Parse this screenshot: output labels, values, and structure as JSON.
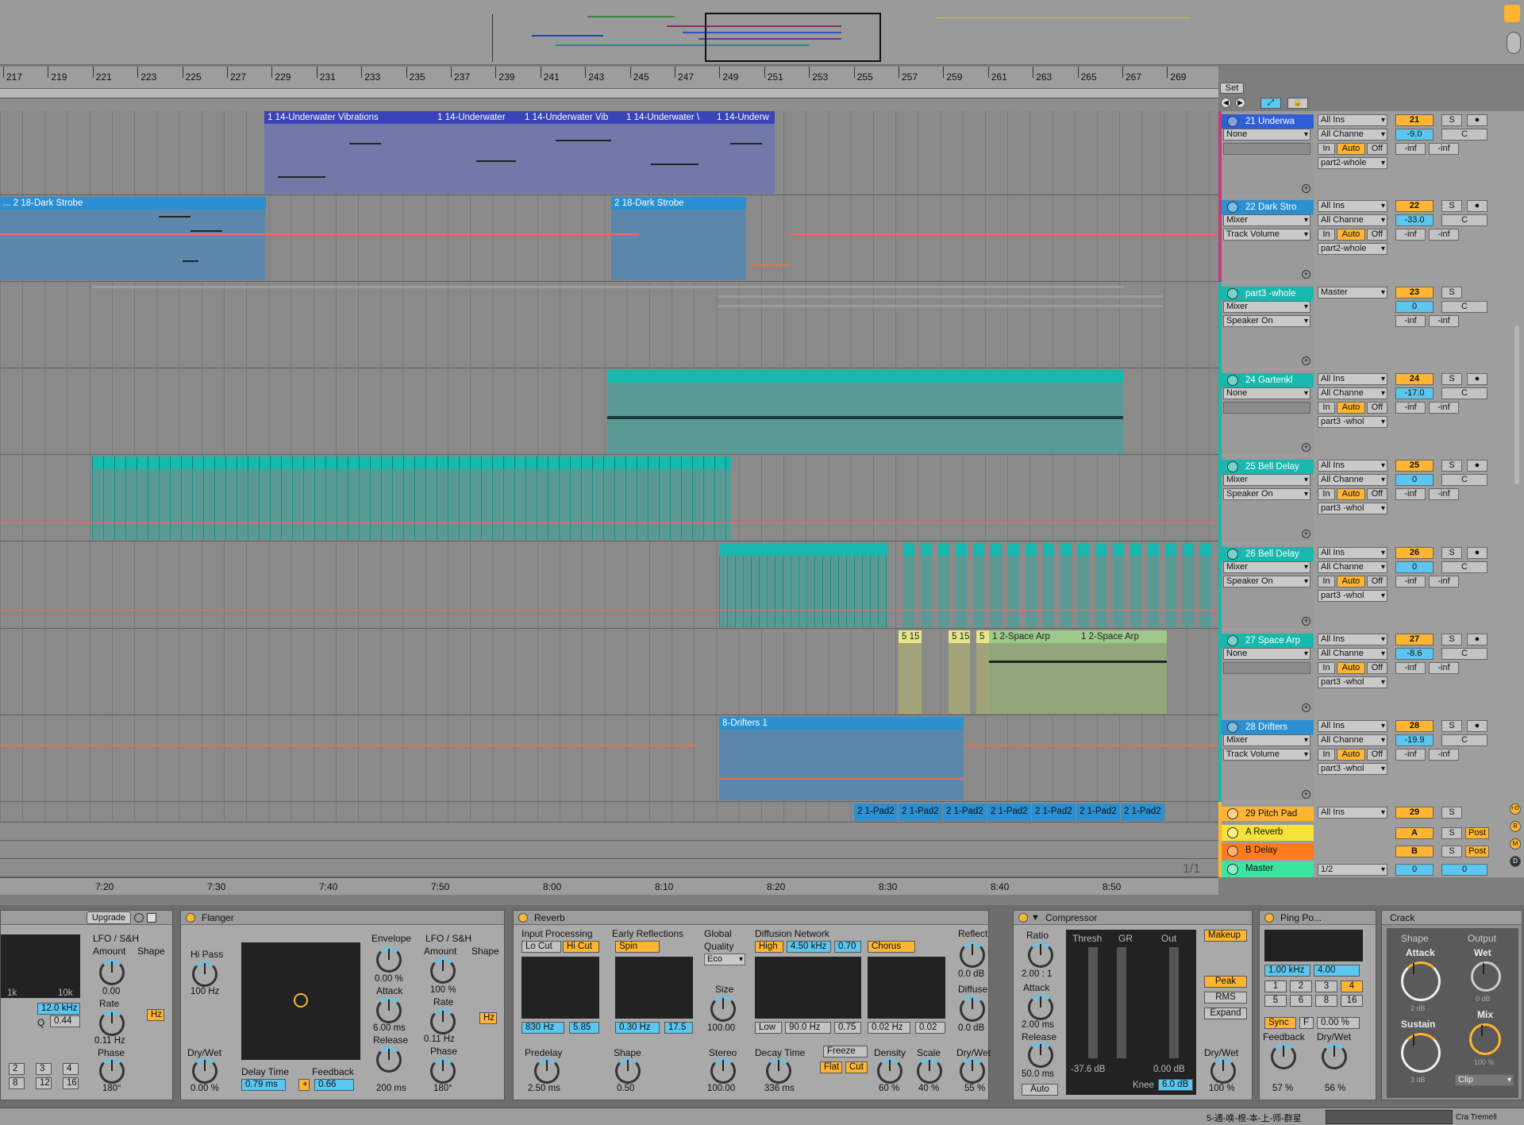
{
  "ruler": {
    "bars": [
      "217",
      "219",
      "221",
      "223",
      "225",
      "227",
      "229",
      "231",
      "233",
      "235",
      "237",
      "239",
      "241",
      "243",
      "245",
      "247",
      "249",
      "251",
      "253",
      "255",
      "257",
      "259",
      "261",
      "263",
      "265",
      "267",
      "269"
    ]
  },
  "time_ruler": {
    "labels": [
      "7:20",
      "7:30",
      "7:40",
      "7:50",
      "8:00",
      "8:10",
      "8:20",
      "8:30",
      "8:40",
      "8:50"
    ],
    "page": "1/1"
  },
  "set_button": "Set",
  "clips": {
    "underwater": [
      "1 14-Underwater Vibrations",
      "1 14-Underwater",
      "1 14-Underwater Vib",
      "1 14-Underwater \\",
      "1 14-Underw"
    ],
    "dark_strobe": [
      "... 2 18-Dark Strobe",
      "2 18-Dark Strobe"
    ],
    "space_arp_short": [
      "5 15",
      "5 15",
      "5"
    ],
    "space_arp": [
      "1 2-Space Arp",
      "1 2-Space Arp"
    ],
    "drifters": "8-Drifters 1",
    "pads": [
      "2 1-Pad2",
      "2 1-Pad2",
      "2 1-Pad2",
      "2 1-Pad2",
      "2 1-Pad2",
      "2 1-Pad2",
      "2 1-Pad2"
    ]
  },
  "tracks": [
    {
      "name": "21 Underwa",
      "color": "#2e5fd6",
      "in": "None",
      "input": "All Ins",
      "channel": "All Channe",
      "mon_in": "In",
      "mon_auto": "Auto",
      "mon_off": "Off",
      "out": "part2-whole",
      "num": "21",
      "vol": "-9.0",
      "pan": "C",
      "s": "S",
      "inf1": "-inf",
      "inf2": "-inf"
    },
    {
      "name": "22 Dark Stro",
      "color": "#2b8fd1",
      "in": "Mixer",
      "sub": "Track Volume",
      "input": "All Ins",
      "channel": "All Channe",
      "mon_in": "In",
      "mon_auto": "Auto",
      "mon_off": "Off",
      "out": "part2-whole",
      "num": "22",
      "vol": "-33.0",
      "pan": "C",
      "s": "S",
      "inf1": "-inf",
      "inf2": "-inf"
    },
    {
      "name": "part3 -whole",
      "color": "#17b8ad",
      "in": "Mixer",
      "sub": "Speaker On",
      "input": "Master",
      "num": "23",
      "vol": "0",
      "pan": "C",
      "s": "S",
      "inf1": "-inf",
      "inf2": "-inf"
    },
    {
      "name": "24 Gartenkl",
      "color": "#17b8ad",
      "in": "None",
      "input": "All Ins",
      "channel": "All Channe",
      "mon_in": "In",
      "mon_auto": "Auto",
      "mon_off": "Off",
      "out": "part3 -whol",
      "num": "24",
      "vol": "-17.0",
      "pan": "C",
      "s": "S",
      "inf1": "-inf",
      "inf2": "-inf"
    },
    {
      "name": "25 Bell Delay",
      "color": "#17b8ad",
      "in": "Mixer",
      "sub": "Speaker On",
      "input": "All Ins",
      "channel": "All Channe",
      "mon_in": "In",
      "mon_auto": "Auto",
      "mon_off": "Off",
      "out": "part3 -whol",
      "num": "25",
      "vol": "0",
      "pan": "C",
      "s": "S",
      "inf1": "-inf",
      "inf2": "-inf"
    },
    {
      "name": "26 Bell Delay",
      "color": "#17b8ad",
      "in": "Mixer",
      "sub": "Speaker On",
      "input": "All Ins",
      "channel": "All Channe",
      "mon_in": "In",
      "mon_auto": "Auto",
      "mon_off": "Off",
      "out": "part3 -whol",
      "num": "26",
      "vol": "0",
      "pan": "C",
      "s": "S",
      "inf1": "-inf",
      "inf2": "-inf"
    },
    {
      "name": "27 Space Arp",
      "color": "#17b8ad",
      "in": "None",
      "input": "All Ins",
      "channel": "All Channe",
      "mon_in": "In",
      "mon_auto": "Auto",
      "mon_off": "Off",
      "out": "part3 -whol",
      "num": "27",
      "vol": "-8.6",
      "pan": "C",
      "s": "S",
      "inf1": "-inf",
      "inf2": "-inf"
    },
    {
      "name": "28 Drifters",
      "color": "#2b8fd1",
      "in": "Mixer",
      "sub": "Track Volume",
      "input": "All Ins",
      "channel": "All Channe",
      "mon_in": "In",
      "mon_auto": "Auto",
      "mon_off": "Off",
      "out": "part3 -whol",
      "num": "28",
      "vol": "-19.9",
      "pan": "C",
      "s": "S",
      "inf1": "-inf",
      "inf2": "-inf"
    },
    {
      "name": "29 Pitch Pad",
      "color": "#ffb531",
      "input": "All Ins",
      "num": "29",
      "s": "S"
    }
  ],
  "returns": [
    {
      "name": "A Reverb",
      "color": "#f5e33b",
      "letter": "A",
      "s": "S",
      "post": "Post"
    },
    {
      "name": "B Delay",
      "color": "#ff7b1c",
      "letter": "B",
      "s": "S",
      "post": "Post"
    },
    {
      "name": "Master",
      "color": "#3ce59f",
      "out": "1/2",
      "vol": "0",
      "pan": "0"
    }
  ],
  "devices": {
    "lfo": {
      "upgrade": "Upgrade",
      "title": "LFO / S&H",
      "amount": "Amount",
      "shape": "Shape",
      "amount_val": "0.00",
      "rate": "Rate",
      "rate_val": "0.11 Hz",
      "phase": "Phase",
      "phase_val": "180°",
      "freq": "12.0 kHz",
      "q": "Q",
      "q_val": "0.44",
      "hz": "Hz",
      "labels": [
        "1k",
        "10k"
      ],
      "nums": [
        "8",
        "12",
        "16",
        "2",
        "3",
        "4"
      ]
    },
    "flanger": {
      "title": "Flanger",
      "hipass": "Hi Pass",
      "hipass_val": "100 Hz",
      "drywet": "Dry/Wet",
      "drywet_val": "0.00 %",
      "delay_time": "Delay Time",
      "delay_val": "0.79 ms",
      "feedback": "Feedback",
      "feedback_val": "0.66",
      "envelope": "Envelope",
      "env_val": "0.00 %",
      "attack": "Attack",
      "attack_val": "6.00 ms",
      "release": "Release",
      "release_val": "200 ms",
      "lfo": "LFO / S&H",
      "amount": "Amount",
      "amount_val": "100 %",
      "shape": "Shape",
      "rate": "Rate",
      "rate_val": "0.11 Hz",
      "phase": "Phase",
      "phase_val": "180°",
      "hz": "Hz"
    },
    "reverb": {
      "title": "Reverb",
      "input": "Input Processing",
      "locut": "Lo Cut",
      "hicut": "Hi Cut",
      "in_freq": "830 Hz",
      "in_q": "5.85",
      "predelay": "Predelay",
      "predelay_val": "2.50 ms",
      "early": "Early Reflections",
      "spin": "Spin",
      "er_freq": "0.30 Hz",
      "er_amt": "17.5",
      "shape": "Shape",
      "shape_val": "0.50",
      "global": "Global",
      "quality": "Quality",
      "quality_val": "Eco",
      "size": "Size",
      "size_val": "100.00",
      "stereo": "Stereo",
      "stereo_val": "100.00",
      "diffusion": "Diffusion Network",
      "high": "High",
      "dn_freq": "4.50 kHz",
      "dn_q": "0.70",
      "chorus": "Chorus",
      "low": "Low",
      "low_freq": "90.0 Hz",
      "low_q": "0.75",
      "ch_rate": "0.02 Hz",
      "ch_amt": "0.02",
      "decay": "Decay Time",
      "decay_val": "336 ms",
      "freeze": "Freeze",
      "flat": "Flat",
      "cut": "Cut",
      "density": "Density",
      "density_val": "60 %",
      "scale": "Scale",
      "scale_val": "40 %",
      "reflect": "Reflect",
      "reflect_val": "0.0 dB",
      "diffuse": "Diffuse",
      "diffuse_val": "0.0 dB",
      "drywet": "Dry/Wet",
      "drywet_val": "55 %"
    },
    "compressor": {
      "title": "Compressor",
      "ratio": "Ratio",
      "ratio_val": "2.00 : 1",
      "attack": "Attack",
      "attack_val": "2.00 ms",
      "release": "Release",
      "release_val": "50.0 ms",
      "auto": "Auto",
      "thresh": "Thresh",
      "gr": "GR",
      "out": "Out",
      "thresh_val": "-37.6 dB",
      "out_val": "0.00 dB",
      "knee": "Knee",
      "knee_val": "6.0 dB",
      "makeup": "Makeup",
      "peak": "Peak",
      "rms": "RMS",
      "expand": "Expand",
      "drywet": "Dry/Wet",
      "drywet_val": "100 %"
    },
    "pingpong": {
      "title": "Ping Po...",
      "freq": "1.00 kHz",
      "width": "4.00",
      "grid": [
        "1",
        "2",
        "3",
        "4",
        "5",
        "6",
        "8",
        "16"
      ],
      "sync": "Sync",
      "f": "F",
      "pct": "0.00 %",
      "feedback": "Feedback",
      "feedback_val": "57 %",
      "drywet": "Dry/Wet",
      "drywet_val": "56 %"
    },
    "crack": {
      "title": "Crack",
      "shape": "Shape",
      "output": "Output",
      "attack": "Attack",
      "attack_val": "2 dB",
      "wet": "Wet",
      "wet_val": "0 dB",
      "sustain": "Sustain",
      "sustain_val": "3 dB",
      "mix": "Mix",
      "mix_val": "100 %",
      "clip": "Clip"
    }
  },
  "status": {
    "text": "5-通-唤-根-本-上-师-群星",
    "device": "Cra Tremell"
  }
}
